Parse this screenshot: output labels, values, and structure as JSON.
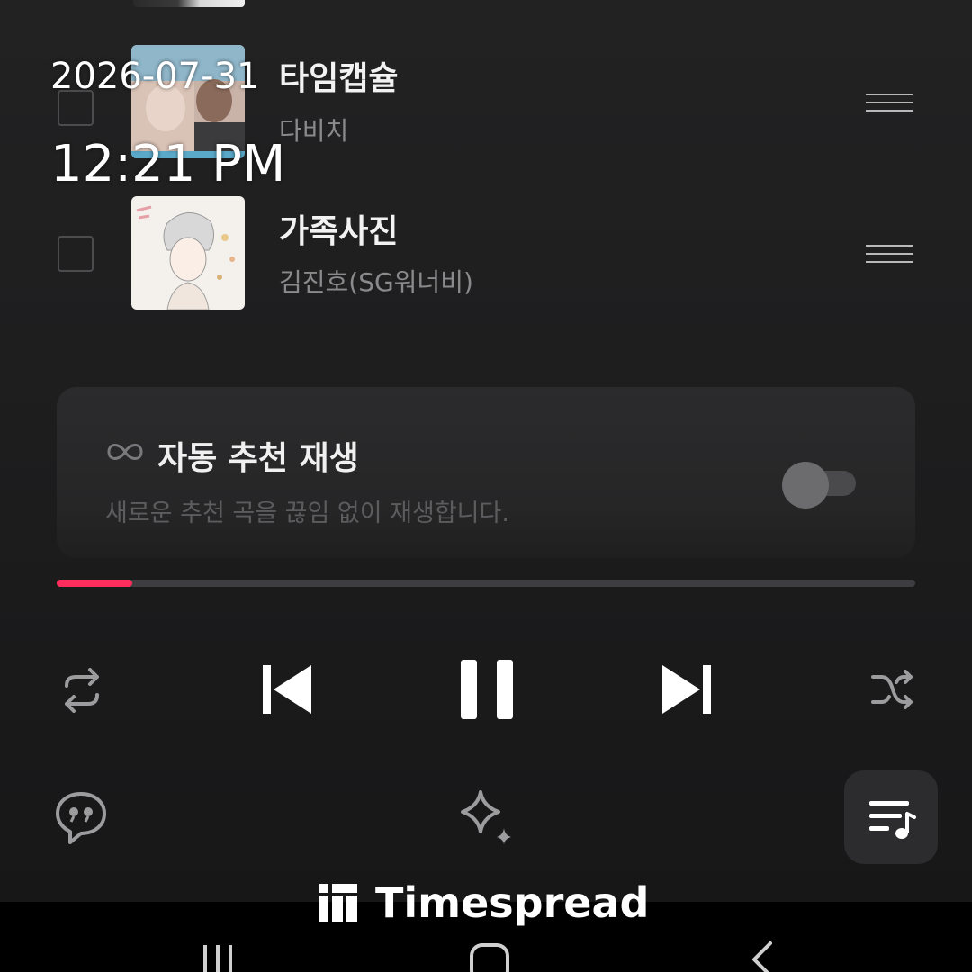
{
  "overlay": {
    "date": "2026-07-31",
    "time": "12:21 PM",
    "brand": "Timespread"
  },
  "queue": [
    {
      "title": "타임캡슐",
      "artist": "다비치",
      "checked": false
    },
    {
      "title": "가족사진",
      "artist": "김진호(SG워너비)",
      "checked": false
    }
  ],
  "autoplay": {
    "title": "자동 추천 재생",
    "description": "새로운 추천 곡을 끊임 없이 재생합니다.",
    "enabled": false
  },
  "player": {
    "progress_fraction": 0.088,
    "state": "playing"
  },
  "colors": {
    "accent": "#ff2d5b",
    "background": "#1b1b1c",
    "card": "#2b2b2d"
  },
  "icons": [
    "repeat-icon",
    "previous-icon",
    "pause-icon",
    "next-icon",
    "shuffle-icon",
    "lyrics-icon",
    "sparkle-icon",
    "playlist-icon",
    "infinity-icon",
    "drag-handle-icon"
  ]
}
